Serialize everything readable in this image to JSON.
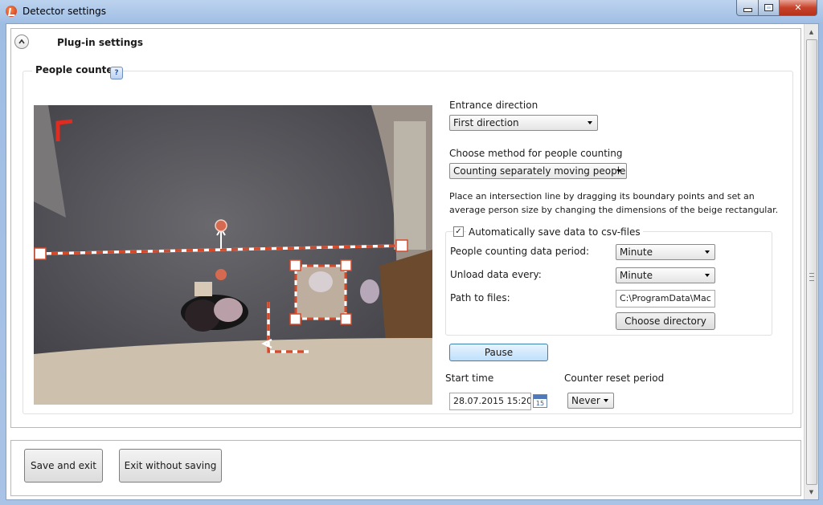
{
  "window": {
    "title": "Detector settings"
  },
  "plugin": {
    "title": "Plug-in settings"
  },
  "group": {
    "title": "People counter",
    "help": "?"
  },
  "entrance": {
    "label": "Entrance direction",
    "value": "First direction"
  },
  "method": {
    "label": "Choose method for people counting",
    "value": "Counting separately moving people"
  },
  "instructions": {
    "line1": "Place an intersection line by dragging its boundary points and set an",
    "line2": "average person size by changing the dimensions of the beige rectangular."
  },
  "autosave": {
    "label": "Automatically save data to csv-files",
    "checked": true
  },
  "period": {
    "label": "People counting data period:",
    "value": "Minute"
  },
  "unload": {
    "label": "Unload data every:",
    "value": "Minute"
  },
  "path": {
    "label": "Path to files:",
    "value": "C:\\ProgramData\\Mac",
    "button": "Choose directory"
  },
  "pause_button": "Pause",
  "start_time": {
    "label": "Start time",
    "value": "28.07.2015 15:20",
    "calendar_day": "15"
  },
  "reset_period": {
    "label": "Counter reset period",
    "value": "Never"
  },
  "footer": {
    "save": "Save and exit",
    "exit": "Exit without saving"
  },
  "colors": {
    "accent": "#d64a2c",
    "pause_button": "#bedffb",
    "titlebar": "#a9c3e6"
  }
}
